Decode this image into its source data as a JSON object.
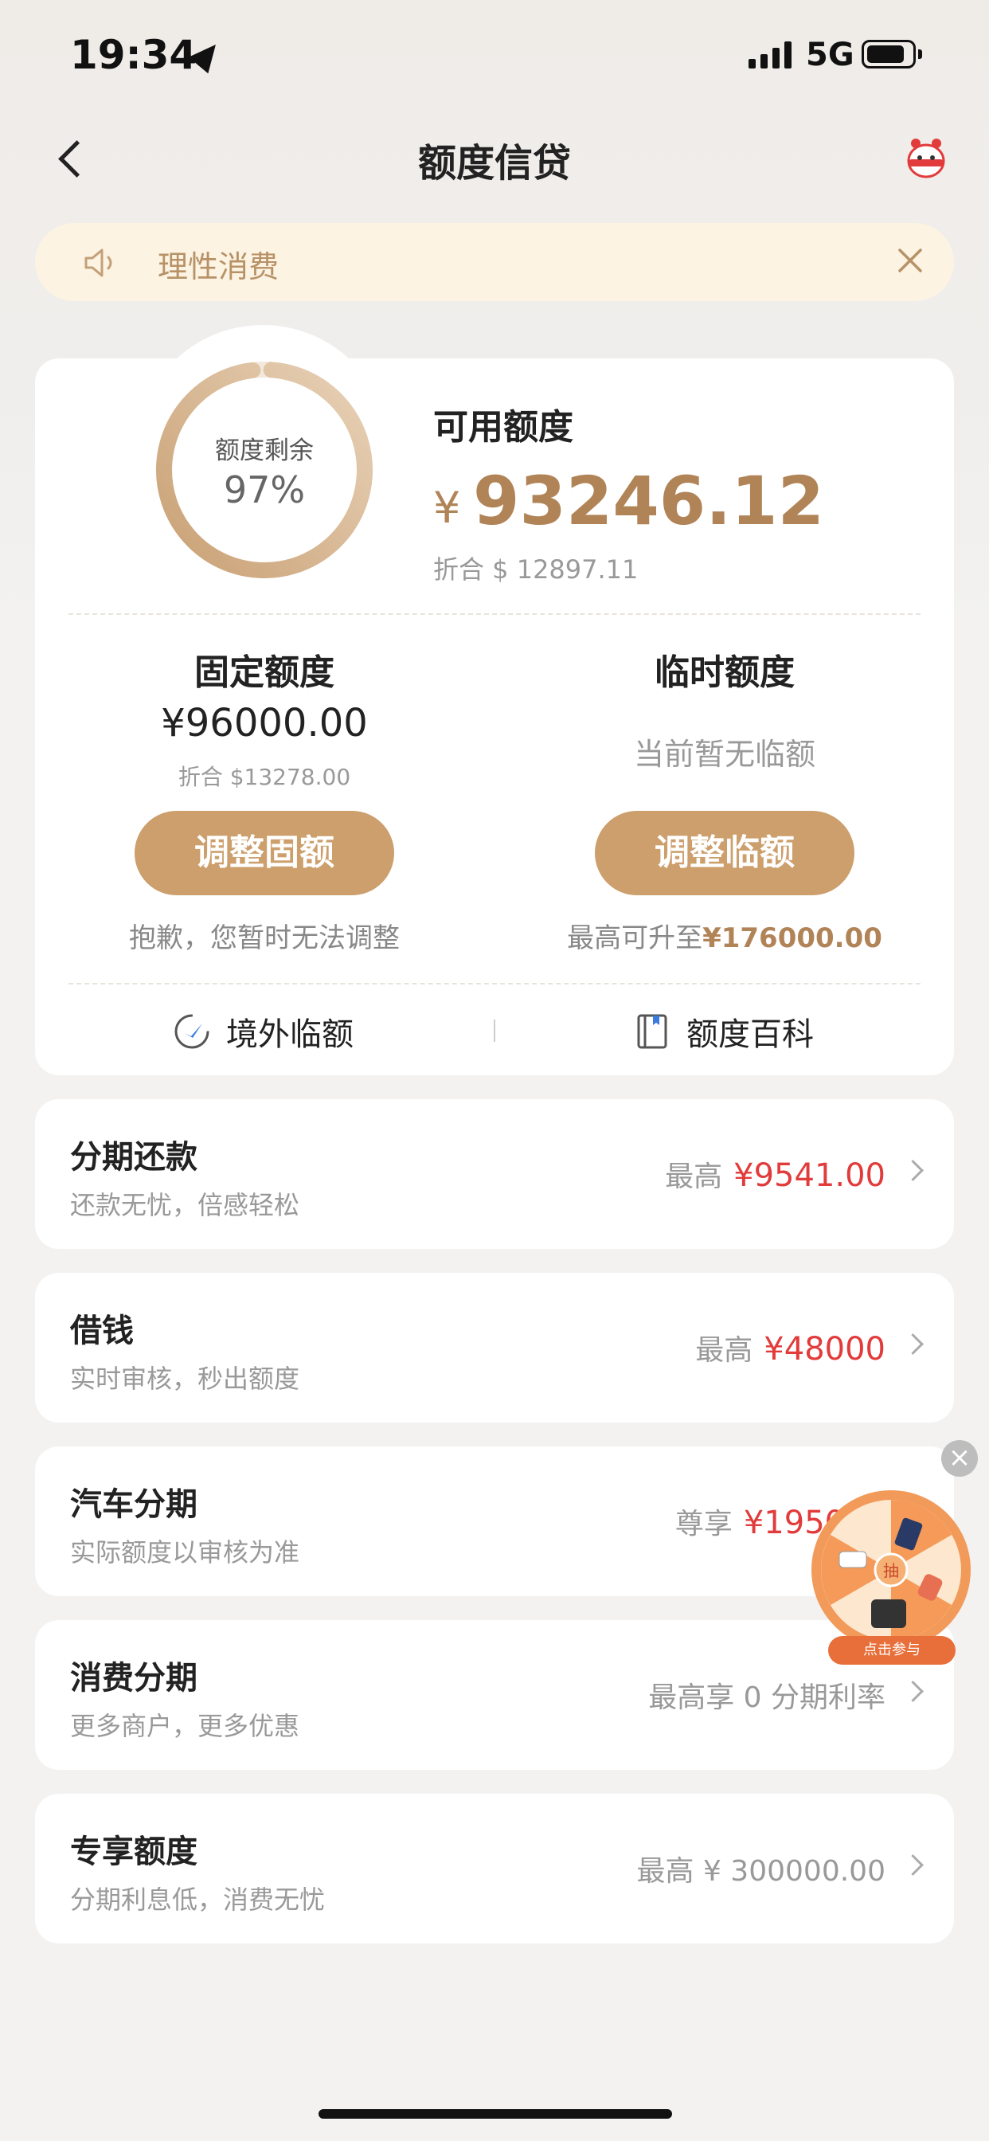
{
  "status_bar": {
    "time": "19:34",
    "network": "5G"
  },
  "nav": {
    "title": "额度信贷"
  },
  "notice": {
    "text": "理性消费"
  },
  "quota": {
    "ring_label": "额度剩余",
    "ring_percent": "97%",
    "ring_fraction": 0.97,
    "available_label": "可用额度",
    "currency": "¥",
    "available_amount": "93246.12",
    "available_usd": "折合 $ 12897.11"
  },
  "fixed": {
    "title": "固定额度",
    "amount": "¥96000.00",
    "usd": "折合 $13278.00",
    "button": "调整固额",
    "note": "抱歉，您暂时无法调整"
  },
  "temporary": {
    "title": "临时额度",
    "status": "当前暂无临额",
    "button": "调整临额",
    "note_prefix": "最高可升至",
    "note_amount": "¥176000.00"
  },
  "links": [
    {
      "label": "境外临额",
      "icon": "plane-icon"
    },
    {
      "label": "额度百科",
      "icon": "book-icon"
    }
  ],
  "list": [
    {
      "title": "分期还款",
      "subtitle": "还款无忧，倍感轻松",
      "prefix": "最高",
      "value": "¥9541.00"
    },
    {
      "title": "借钱",
      "subtitle": "实时审核，秒出额度",
      "prefix": "最高",
      "value": "¥48000"
    },
    {
      "title": "汽车分期",
      "subtitle": "实际额度以审核为准",
      "prefix": "尊享",
      "value": "¥195000"
    },
    {
      "title": "消费分期",
      "subtitle": "更多商户，更多优惠",
      "prefix": "最高享 0 分期利率",
      "value": ""
    },
    {
      "title": "专享额度",
      "subtitle": "分期利息低，消费无忧",
      "prefix": "最高 ¥ 300000.00",
      "value": ""
    }
  ],
  "widget": {
    "center": "抽",
    "cta": "点击参与",
    "close": "×"
  },
  "colors": {
    "gold": "#cc9f6c",
    "gold_text": "#b18458",
    "red": "#e23b3b",
    "notice_bg": "#fcf3e3"
  }
}
